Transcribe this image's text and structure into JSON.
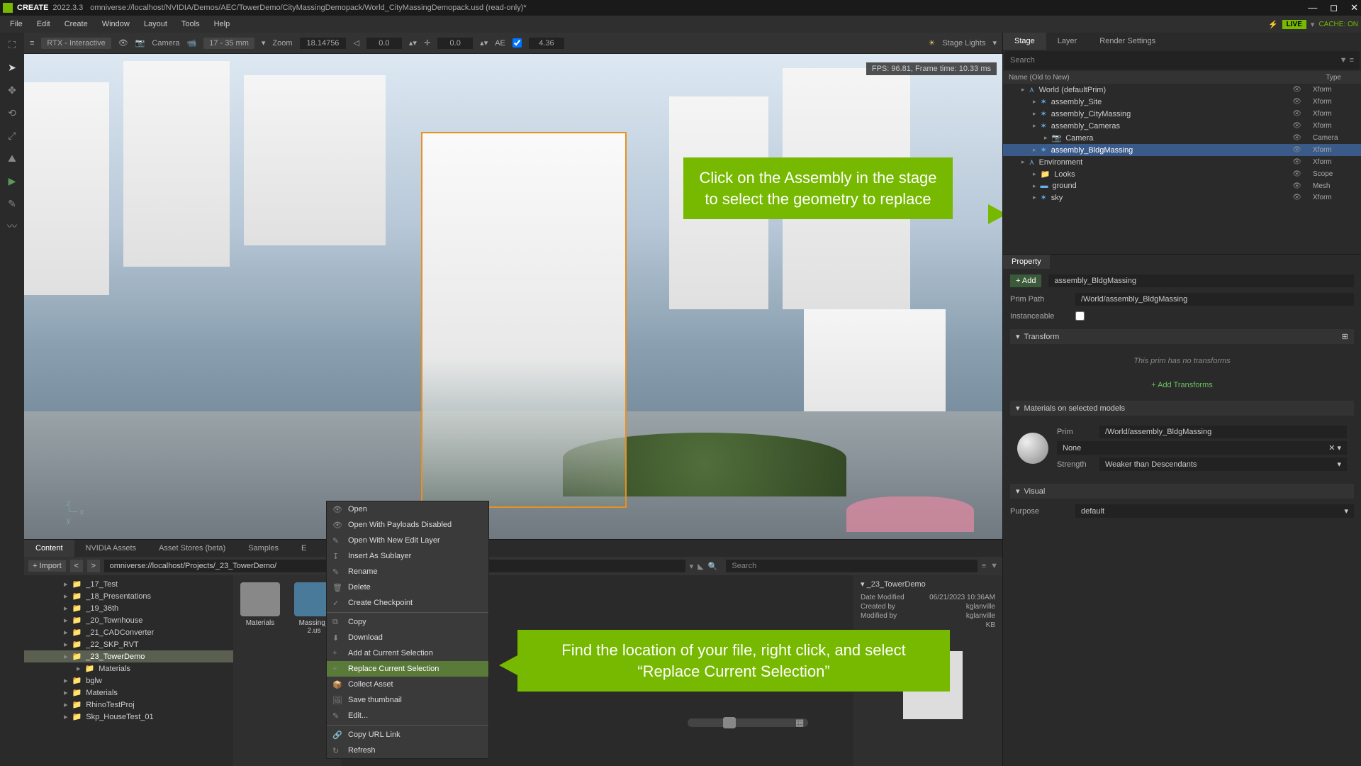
{
  "titlebar": {
    "app": "CREATE",
    "version": "2022.3.3",
    "path": "omniverse://localhost/NVIDIA/Demos/AEC/TowerDemo/CityMassingDemopack/World_CityMassingDemopack.usd (read-only)*",
    "live": "LIVE",
    "cache": "CACHE: ON"
  },
  "menubar": [
    "File",
    "Edit",
    "Create",
    "Window",
    "Layout",
    "Tools",
    "Help"
  ],
  "vp": {
    "renderer": "RTX - Interactive",
    "camera": "Camera",
    "lens": "17 - 35 mm",
    "zoom_lbl": "Zoom",
    "zoom": "18.14756",
    "ev1": "0.0",
    "ev2": "0.0",
    "ae": "AE",
    "exposure": "4.36",
    "lights": "Stage Lights",
    "fps": "FPS: 96.81, Frame time: 10.33 ms"
  },
  "callouts": {
    "c1": "Click on the Assembly in the stage to select the geometry to replace",
    "c2": "Find the location of your file, right click, and select “Replace Current Selection”"
  },
  "btabs": [
    "Content",
    "NVIDIA Assets",
    "Asset Stores (beta)",
    "Samples",
    "E"
  ],
  "path": {
    "import": "+ Import",
    "value": "omniverse://localhost/Projects/_23_TowerDemo/",
    "search_ph": "Search"
  },
  "tree": [
    {
      "n": "_17_Test"
    },
    {
      "n": "_18_Presentations"
    },
    {
      "n": "_19_36th"
    },
    {
      "n": "_20_Townhouse"
    },
    {
      "n": "_21_CADConverter"
    },
    {
      "n": "_22_SKP_RVT"
    },
    {
      "n": "_23_TowerDemo",
      "sel": true
    },
    {
      "n": "Materials",
      "sub": true
    },
    {
      "n": "bglw"
    },
    {
      "n": "Materials"
    },
    {
      "n": "RhinoTestProj"
    },
    {
      "n": "Skp_HouseTest_01"
    }
  ],
  "thumbs": [
    {
      "n": "Materials"
    },
    {
      "n": "Massing_\n2.us"
    }
  ],
  "ctx": [
    {
      "i": "👁",
      "t": "Open"
    },
    {
      "i": "👁",
      "t": "Open With Payloads Disabled"
    },
    {
      "i": "✎",
      "t": "Open With New Edit Layer"
    },
    {
      "i": "↧",
      "t": "Insert As Sublayer"
    },
    {
      "i": "✎",
      "t": "Rename"
    },
    {
      "i": "🗑",
      "t": "Delete"
    },
    {
      "i": "✓",
      "t": "Create Checkpoint"
    },
    {
      "sep": true
    },
    {
      "i": "⧉",
      "t": "Copy"
    },
    {
      "i": "⬇",
      "t": "Download"
    },
    {
      "i": "+",
      "t": "Add at Current Selection"
    },
    {
      "i": "+",
      "t": "Replace Current Selection",
      "hl": true
    },
    {
      "i": "📦",
      "t": "Collect Asset"
    },
    {
      "i": "🖼",
      "t": "Save thumbnail"
    },
    {
      "i": "✎",
      "t": "Edit..."
    },
    {
      "sep": true
    },
    {
      "i": "🔗",
      "t": "Copy URL Link"
    },
    {
      "i": "↻",
      "t": "Refresh"
    }
  ],
  "info": {
    "title": "_23_TowerDemo",
    "rows": [
      [
        "Date Modified",
        "06/21/2023 10:36AM"
      ],
      [
        "Created by",
        "kglanville"
      ],
      [
        "Modified by",
        "kglanville"
      ],
      [
        "",
        "KB"
      ]
    ]
  },
  "rtabs": [
    "Stage",
    "Layer",
    "Render Settings"
  ],
  "stage": {
    "search_ph": "Search",
    "name_col": "Name (Old to New)",
    "type_col": "Type",
    "rows": [
      {
        "d": 0,
        "ic": "⋏",
        "n": "World (defaultPrim)",
        "t": "Xform"
      },
      {
        "d": 1,
        "ic": "✶",
        "n": "assembly_Site",
        "t": "Xform"
      },
      {
        "d": 1,
        "ic": "✶",
        "n": "assembly_CityMassing",
        "t": "Xform"
      },
      {
        "d": 1,
        "ic": "✶",
        "n": "assembly_Cameras",
        "t": "Xform"
      },
      {
        "d": 2,
        "ic": "📷",
        "n": "Camera",
        "t": "Camera"
      },
      {
        "d": 1,
        "ic": "✶",
        "n": "assembly_BldgMassing",
        "t": "Xform",
        "sel": true
      },
      {
        "d": 0,
        "ic": "⋏",
        "n": "Environment",
        "t": "Xform"
      },
      {
        "d": 1,
        "ic": "📁",
        "n": "Looks",
        "t": "Scope"
      },
      {
        "d": 1,
        "ic": "▬",
        "n": "ground",
        "t": "Mesh"
      },
      {
        "d": 1,
        "ic": "✶",
        "n": "sky",
        "t": "Xform"
      }
    ]
  },
  "prop": {
    "tab": "Property",
    "add": "Add",
    "name": "assembly_BldgMassing",
    "primpath_lbl": "Prim Path",
    "primpath": "/World/assembly_BldgMassing",
    "instance_lbl": "Instanceable",
    "transform": "Transform",
    "no_tf": "This prim has no transforms",
    "add_tf": "+ Add Transforms",
    "mats_hdr": "Materials on selected models",
    "prim_lbl": "Prim",
    "prim_val": "/World/assembly_BldgMassing",
    "none": "None",
    "strength_lbl": "Strength",
    "strength": "Weaker than Descendants",
    "visual": "Visual",
    "purpose_lbl": "Purpose",
    "purpose": "default"
  }
}
